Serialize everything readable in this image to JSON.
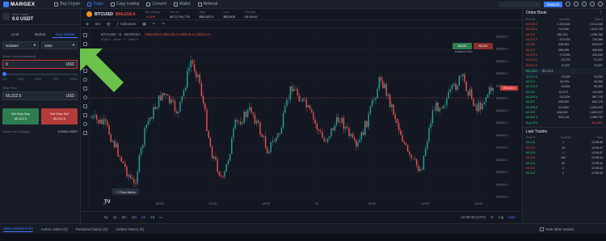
{
  "brand": {
    "name": "MARGEX"
  },
  "nav": {
    "items": [
      {
        "label": "Buy Crypto",
        "icon": "card-icon"
      },
      {
        "label": "Trade",
        "icon": "chart-icon"
      },
      {
        "label": "Copy trading",
        "icon": "copy-icon"
      },
      {
        "label": "Convert",
        "icon": "convert-icon"
      },
      {
        "label": "Wallet",
        "icon": "wallet-icon"
      },
      {
        "label": "Referral",
        "icon": "people-icon"
      }
    ],
    "deposit_label": "Deposit"
  },
  "wallet": {
    "label": "Main Trade",
    "value": "0.0 USDT"
  },
  "order_form": {
    "tabs": [
      "Limit",
      "Market",
      "Stop Market"
    ],
    "margin_mode": "Isolated",
    "leverage": "100x",
    "order_size_label": "Order Size (contingent)",
    "order_size_value": "0",
    "order_size_unit": "USD",
    "slider_ticks": [
      "0%",
      "25%",
      "50%",
      "75%",
      "100%"
    ],
    "stop_price_label": "Stop Price",
    "stop_price_value": "65,312.5",
    "stop_price_unit": "USD",
    "buy_label": "Set Stop Buy",
    "buy_sub": "65,312.5",
    "sell_label": "Set Stop Sell",
    "sell_sub": "65,312.5",
    "margin_label": "Order cost (Margin)",
    "margin_value": "0.0000 USDT"
  },
  "instrument": {
    "symbol": "BTCUSD",
    "price": "$64,018.0",
    "stats": [
      {
        "k": "24h change",
        "v": "-0.28%",
        "neg": true
      },
      {
        "k": "24h vol",
        "v": "$172,794,778"
      },
      {
        "k": "High",
        "v": "$65,622.5"
      },
      {
        "k": "Low",
        "v": "$63,905"
      },
      {
        "k": "Funding",
        "v": "04:00:42"
      }
    ]
  },
  "chart_toolbar": {
    "timeframe": "5m",
    "indicators_label": "Indicators"
  },
  "chart": {
    "legend": "BTCUSD · 5 · MARGEX",
    "ohlc": "O65128.0 H65149.0 L65076.0 C65112.0",
    "sub": "EMA 9 · close · 0 · SMA 9",
    "buy_btn": "65,312",
    "sell_btn": "65,310",
    "iso_label": "Isolated 100x",
    "last_price": "65,312.0",
    "price_news": "Price Alerts",
    "y_ticks": [
      "66000.0",
      "65800.0",
      "65600.0",
      "65400.0",
      "65200.0",
      "65000.0",
      "64800.0",
      "64600.0",
      "64400.0",
      "64200.0",
      "64000.0",
      "63800.0",
      "63600.0",
      "63400.0"
    ],
    "x_ticks": [
      "18",
      "06:00",
      "12:00",
      "18:00",
      "20",
      "06:00",
      "12:00",
      "18:00"
    ],
    "timeframes": [
      "5y",
      "1y",
      "3m",
      "1m",
      "5d",
      "1d"
    ],
    "active_tf": "5d",
    "bottom_right": {
      "time": "12:05:48 (UTC)",
      "pct": "%",
      "log": "log",
      "auto": "auto"
    }
  },
  "orderbook": {
    "title": "Order Book",
    "cols": [
      "Price $",
      "Quantity",
      "Total $"
    ],
    "asks": [
      [
        "65,326.5",
        "1,200,518",
        "2,014,150"
      ],
      [
        "65,323.5",
        "714,046",
        "1,813,704"
      ],
      [
        "65,322",
        "382,700",
        "1,098,766"
      ],
      [
        "65,321.5",
        "479,018",
        "716,066"
      ],
      [
        "65,320",
        "336,903",
        "816,047"
      ],
      [
        "65,319",
        "296,098",
        "996,542"
      ],
      [
        "65,317.5",
        "173,095",
        "233,046"
      ],
      [
        "65,314.5",
        "16,703",
        "21,437"
      ],
      [
        "65,312.5",
        "10,007",
        "10,007"
      ]
    ],
    "mid": {
      "price": "65,312",
      "mark": "65,314"
    },
    "bids": [
      [
        "65,312.5",
        "15,530",
        "15,530"
      ],
      [
        "65,312",
        "20,976",
        "36,496"
      ],
      [
        "65,310.5",
        "16,904",
        "53,400"
      ],
      [
        "65,310",
        "81,070",
        "134,623"
      ],
      [
        "65,309.5",
        "210,200",
        "367,776"
      ],
      [
        "65,307",
        "236,599",
        "603,175"
      ],
      [
        "65,305.5",
        "412,820",
        "1,016,015"
      ],
      [
        "65,303",
        "638,953",
        "1,893,227"
      ],
      [
        "65,302.5",
        "530,143",
        "2,385,709"
      ]
    ],
    "ratio": {
      "buy": "Buy 44%",
      "sell": "Sell 56%"
    },
    "last_trades_title": "Last Trades",
    "lt_cols": [
      "Price $",
      "Quantity",
      "Time"
    ],
    "trades": [
      [
        "65,310",
        "1",
        "12:05:46"
      ],
      [
        "65,310",
        "15",
        "12:05:47"
      ],
      [
        "65,310",
        "1",
        "12:05:47"
      ],
      [
        "65,314",
        "160",
        "12:05:44"
      ],
      [
        "65,314",
        "40",
        "12:05:44"
      ],
      [
        "65,310",
        "2",
        "12:05:44"
      ],
      [
        "65,313",
        "1",
        "12:05:44"
      ]
    ]
  },
  "bottom_tabs": {
    "items": [
      "Open positions (0)",
      "Active orders (0)",
      "Positions history (0)",
      "Orders history (0)"
    ],
    "hide_label": "Hide other assets"
  },
  "colors": {
    "accent": "#3a7bfd",
    "up": "#2ecc71",
    "down": "#e74c3c",
    "arrow": "#6cc24a"
  }
}
